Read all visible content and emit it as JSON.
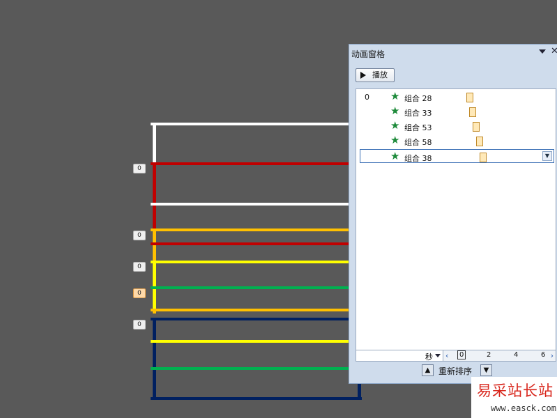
{
  "colors": {
    "background": "#595959",
    "white": "#ffffff",
    "red": "#c00000",
    "orange": "#ffc000",
    "yellow": "#ffff00",
    "green": "#00b050",
    "navy": "#002060"
  },
  "slide_tags": [
    {
      "label": "0",
      "highlighted": false
    },
    {
      "label": "0",
      "highlighted": false
    },
    {
      "label": "0",
      "highlighted": false
    },
    {
      "label": "0",
      "highlighted": true
    },
    {
      "label": "0",
      "highlighted": false
    }
  ],
  "pane": {
    "title": "动画窗格",
    "close_icon": "✕",
    "play_label": "播放",
    "items": [
      {
        "index": "0",
        "name": "组合 28",
        "selected": false
      },
      {
        "index": "",
        "name": "组合 33",
        "selected": false
      },
      {
        "index": "",
        "name": "组合 53",
        "selected": false
      },
      {
        "index": "",
        "name": "组合 58",
        "selected": false
      },
      {
        "index": "",
        "name": "组合 38",
        "selected": true
      }
    ],
    "timeline": {
      "unit": "秒",
      "ticks": [
        "0",
        "2",
        "4",
        "6"
      ],
      "prev_icon": "‹",
      "next_icon": "›"
    },
    "reorder_label": "重新排序"
  },
  "watermark": {
    "text": "易采站长站",
    "url": "www.easck.com"
  }
}
